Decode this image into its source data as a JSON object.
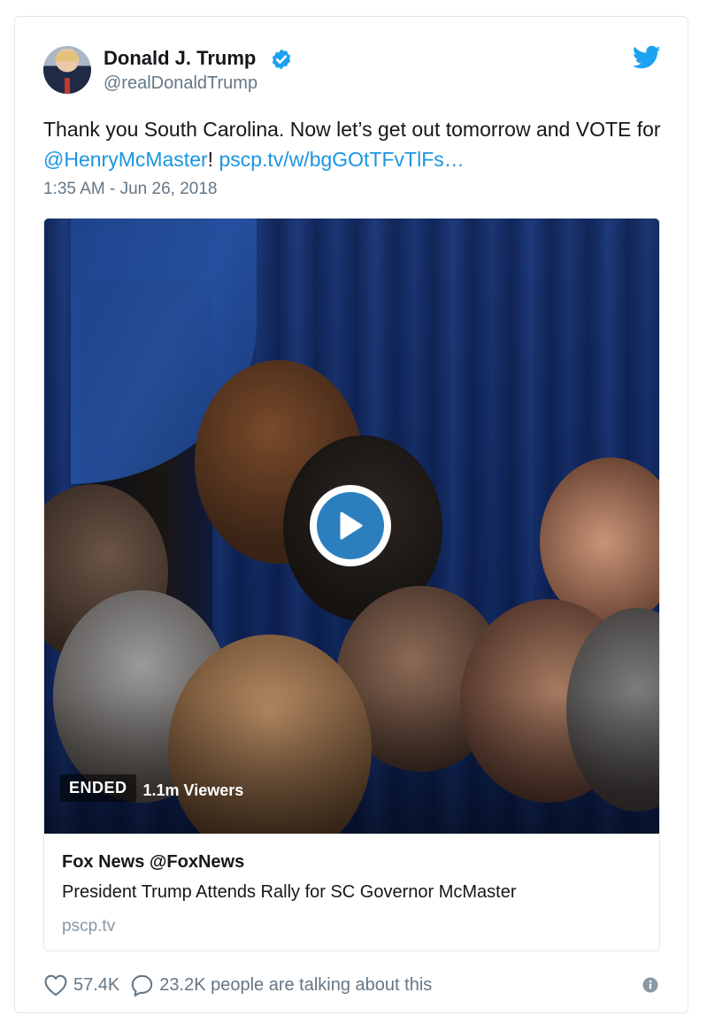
{
  "tweet": {
    "author_name": "Donald J. Trump",
    "handle": "@realDonaldTrump",
    "text_before": "Thank you South Carolina. Now let’s get out tomorrow and VOTE for ",
    "mention": "@HenryMcMaster",
    "text_between": "! ",
    "link": "pscp.tv/w/bgGOtTFvTlFs…",
    "timestamp": "1:35 AM - Jun 26, 2018"
  },
  "media_card": {
    "status_badge": "ENDED",
    "viewers": "1.1m Viewers",
    "author": "Fox News @FoxNews",
    "title": "President Trump Attends Rally for SC Governor McMaster",
    "domain": "pscp.tv"
  },
  "actions": {
    "likes": "57.4K",
    "replies": "23.2K people are talking about this"
  },
  "icons": {
    "verified": "verified-badge-icon",
    "brand": "twitter-bird-icon",
    "play": "play-icon",
    "like": "heart-icon",
    "reply": "comment-bubble-icon",
    "info": "info-icon"
  },
  "colors": {
    "link": "#1b95e0",
    "verified": "#1da1f2",
    "secondary_text": "#657786",
    "play_button": "#2c7fbf"
  }
}
